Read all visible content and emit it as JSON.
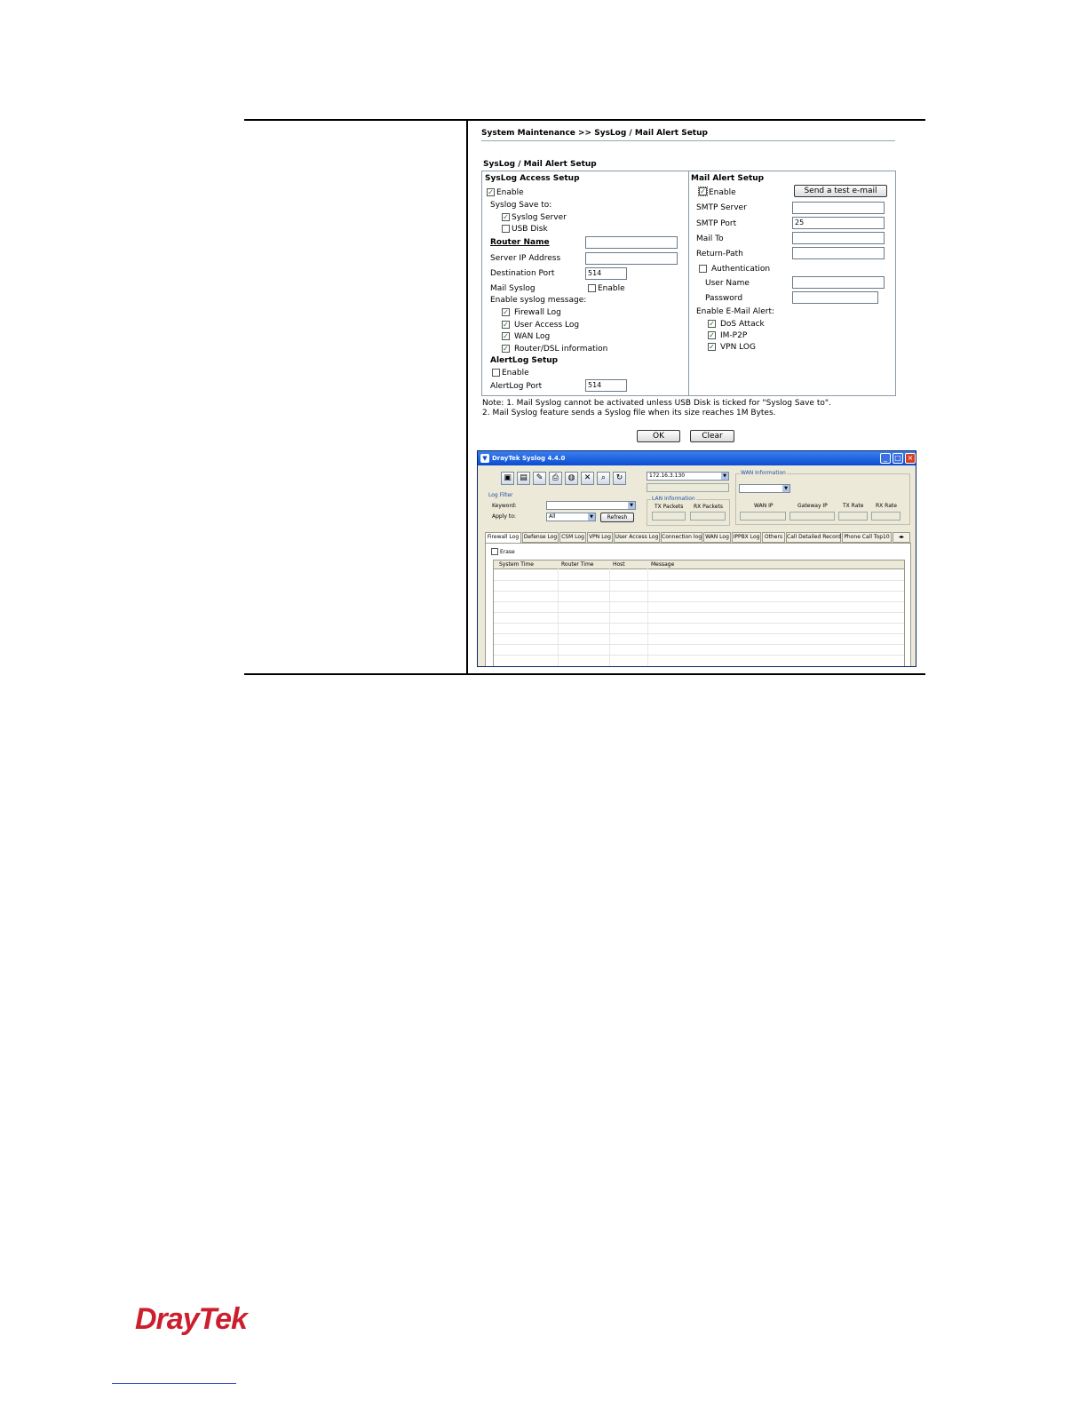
{
  "webui": {
    "breadcrumb": "System Maintenance >> SysLog / Mail Alert Setup",
    "section_title": "SysLog / Mail Alert Setup",
    "syslog": {
      "title": "SysLog Access Setup",
      "enable": "Enable",
      "save_to": "Syslog Save to:",
      "syslog_server": "Syslog Server",
      "usb_disk": "USB Disk",
      "router_name": "Router Name",
      "server_ip": "Server IP Address",
      "dest_port": "Destination Port",
      "dest_port_value": "514",
      "mail_syslog": "Mail Syslog",
      "mail_syslog_enable": "Enable",
      "enable_msg": "Enable syslog message:",
      "firewall_log": "Firewall Log",
      "user_access_log": "User Access Log",
      "wan_log": "WAN Log",
      "router_dsl": "Router/DSL information",
      "alertlog_title": "AlertLog Setup",
      "alertlog_enable": "Enable",
      "alertlog_port": "AlertLog Port",
      "alertlog_port_value": "514"
    },
    "mail": {
      "title": "Mail Alert Setup",
      "enable": "Enable",
      "send_test": "Send a test e-mail",
      "smtp_server": "SMTP Server",
      "smtp_port": "SMTP Port",
      "smtp_port_value": "25",
      "mail_to": "Mail To",
      "return_path": "Return-Path",
      "authentication": "Authentication",
      "user_name": "User Name",
      "password": "Password",
      "enable_alert": "Enable E-Mail Alert:",
      "dos_attack": "DoS Attack",
      "im_p2p": "IM-P2P",
      "vpn_log": "VPN LOG"
    },
    "note_1": "Note:  1. Mail Syslog cannot be activated unless USB Disk is ticked for \"Syslog Save to\".",
    "note_2": "2. Mail Syslog feature sends a Syslog file when its size reaches 1M Bytes.",
    "ok": "OK",
    "clear": "Clear"
  },
  "syslog_app": {
    "title": "DrayTek Syslog 4.4.0",
    "ip_value": "172.16.3.130",
    "wan_info": "WAN Information",
    "log_filter": "Log Filter",
    "keyword": "Keyword:",
    "apply_to": "Apply to:",
    "apply_value": "All",
    "refresh": "Refresh",
    "lan_info": "LAN Information",
    "tx_packets": "TX Packets",
    "rx_packets": "RX Packets",
    "wan_ip": "WAN IP",
    "gateway_ip": "Gateway IP",
    "tx_rate": "TX Rate",
    "rx_rate": "RX Rate",
    "tabs": [
      "Firewall Log",
      "Defense Log",
      "CSM Log",
      "VPN Log",
      "User Access Log",
      "Connection log",
      "WAN Log",
      "IPPBX Log",
      "Others",
      "Call Detailed Record",
      "Phone Call Top10"
    ],
    "erase": "Erase",
    "columns": [
      "System Time",
      "Router Time",
      "Host",
      "Message"
    ]
  },
  "footer": {
    "logo": "DrayTek"
  }
}
